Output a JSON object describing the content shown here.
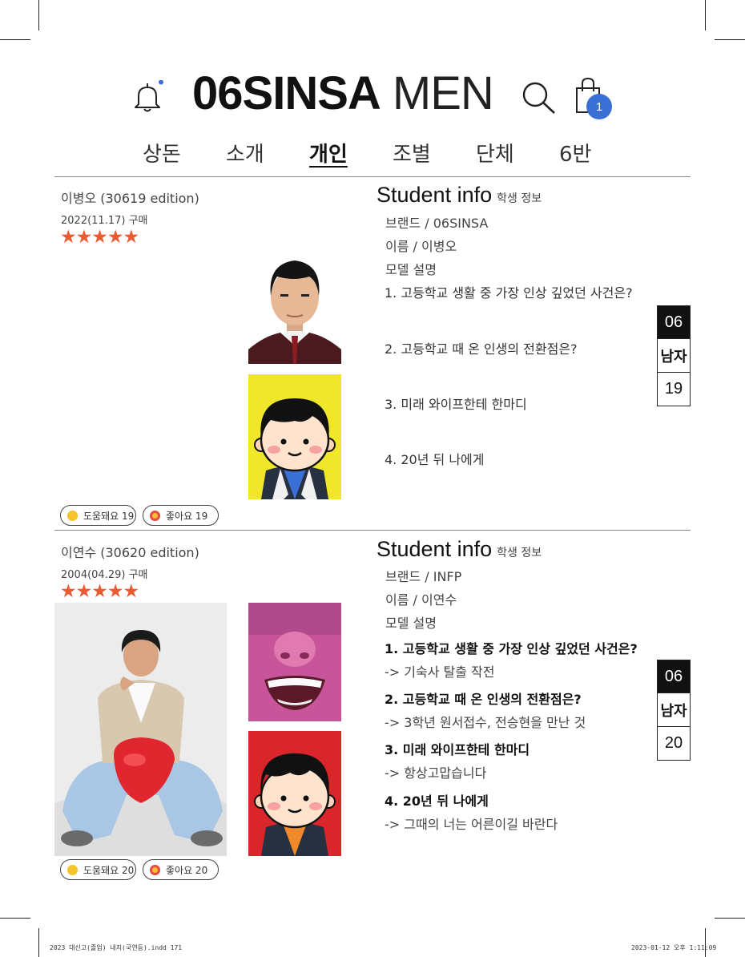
{
  "header": {
    "title_bold": "06SINSA",
    "title_light": "MEN",
    "cart_count": "1"
  },
  "nav": {
    "items": [
      "상돈",
      "소개",
      "개인",
      "조별",
      "단체",
      "6반"
    ],
    "active_index": 2
  },
  "students": [
    {
      "name": "이병오 (30619 edition)",
      "date": "2022(11.17) 구매",
      "rating": 5,
      "info_title": "Student info",
      "info_sub": "학생 정보",
      "brand": "브랜드 / 06SINSA",
      "person_name": "이름 / 이병오",
      "model_desc": "모델 설명",
      "q1": "1. 고등학교 생활 중 가장 인상 깊었던 사건은?",
      "q2": "2. 고등학교 때 온 인생의 전환점은?",
      "q3": "3. 미래 와이프한테 한마디",
      "q4": "4. 20년 뒤 나에게",
      "a1": "",
      "a2": "",
      "a3": "",
      "a4": "",
      "helpful": "도움돼요 19",
      "like": "좋아요 19",
      "tab_class": "06",
      "tab_gender": "남자",
      "tab_num": "19",
      "avatar_bg": "#f0e62a",
      "avatar_shirt": "#3a6fd6"
    },
    {
      "name": "이연수 (30620 edition)",
      "date": "2004(04.29) 구매",
      "rating": 5,
      "info_title": "Student info",
      "info_sub": "학생 정보",
      "brand": "브랜드 / INFP",
      "person_name": "이름 / 이연수",
      "model_desc": "모델 설명",
      "q1": "1. 고등학교 생활 중 가장 인상 깊었던 사건은?",
      "q2": "2. 고등학교 때 온 인생의 전환점은?",
      "q3": "3. 미래 와이프한테 한마디",
      "q4": "4. 20년 뒤 나에게",
      "a1": "-> 기숙사 탈출 작전",
      "a2": "-> 3학년 원서접수, 전승현을 만난 것",
      "a3": "-> 항상고맙습니다",
      "a4": "-> 그때의 너는 어른이길 바란다",
      "helpful": "도움돼요 20",
      "like": "좋아요 20",
      "tab_class": "06",
      "tab_gender": "남자",
      "tab_num": "20",
      "avatar_bg": "#d8262a",
      "avatar_shirt": "#f08a2a"
    }
  ],
  "footer": {
    "left": "2023 대신고(졸업) 내지(국연등).indd   171",
    "right": "2023-01-12   오후 1:11:09"
  },
  "colors": {
    "accent": "#3a6fd6",
    "star": "#ea5a33"
  }
}
